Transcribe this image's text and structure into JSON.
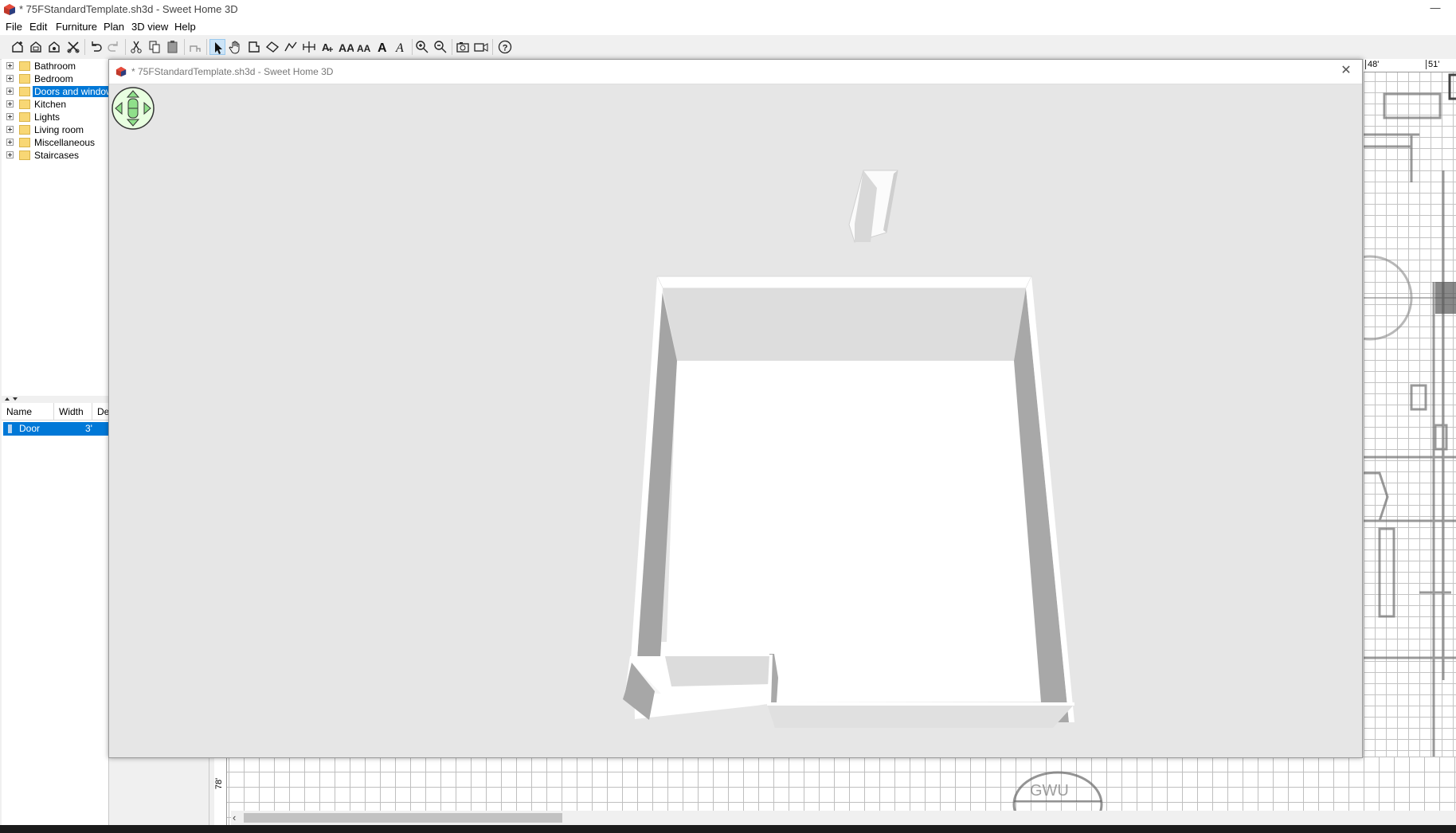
{
  "window": {
    "title": "* 75FStandardTemplate.sh3d - Sweet Home 3D",
    "minimize": "—"
  },
  "menu": {
    "items": [
      "File",
      "Edit",
      "Furniture",
      "Plan",
      "3D view",
      "Help"
    ]
  },
  "toolbar": {
    "icons": [
      "new-home-icon",
      "open-icon",
      "save-icon",
      "cut-tool-icon",
      "undo-icon",
      "redo-icon",
      "cut-icon",
      "copy-icon",
      "paste-icon",
      "add-furniture-icon",
      "select-icon",
      "pan-icon",
      "create-walls-icon",
      "create-rooms-icon",
      "create-polylines-icon",
      "create-dimensions-icon",
      "create-labels-icon",
      "increase-text-icon",
      "decrease-text-icon",
      "bold-text-icon",
      "italic-text-icon",
      "zoom-in-icon",
      "zoom-out-icon",
      "create-photo-icon",
      "create-video-icon",
      "help-icon"
    ],
    "active": "select-icon"
  },
  "catalog": {
    "items": [
      "Bathroom",
      "Bedroom",
      "Doors and windows",
      "Kitchen",
      "Lights",
      "Living room",
      "Miscellaneous",
      "Staircases"
    ],
    "selected": "Doors and windows"
  },
  "furniture_table": {
    "columns": [
      "Name",
      "Width",
      "De"
    ],
    "rows": [
      {
        "name": "Door",
        "width": "3'"
      }
    ]
  },
  "plan": {
    "ruler_top": [
      "48'",
      "51'"
    ],
    "ruler_left": "78'"
  },
  "view3d": {
    "title": "* 75FStandardTemplate.sh3d - Sweet Home 3D",
    "close": "✕"
  },
  "colors": {
    "selection": "#0078d7",
    "floor": "#ffffff",
    "wall_shade": "#a6a6a6",
    "background": "#e6e6e6"
  }
}
